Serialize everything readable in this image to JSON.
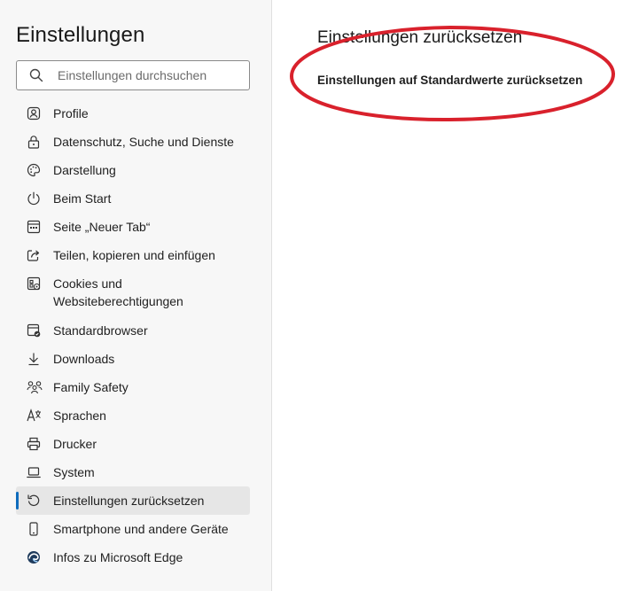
{
  "sidebar": {
    "title": "Einstellungen",
    "search": {
      "placeholder": "Einstellungen durchsuchen",
      "value": ""
    },
    "items": [
      {
        "label": "Profile",
        "icon": "profile-icon"
      },
      {
        "label": "Datenschutz, Suche und Dienste",
        "icon": "lock-icon"
      },
      {
        "label": "Darstellung",
        "icon": "palette-icon"
      },
      {
        "label": "Beim Start",
        "icon": "power-icon"
      },
      {
        "label": "Seite „Neuer Tab“",
        "icon": "new-tab-icon"
      },
      {
        "label": "Teilen, kopieren und einfügen",
        "icon": "share-icon"
      },
      {
        "label": "Cookies und Websiteberechtigungen",
        "icon": "cookies-icon"
      },
      {
        "label": "Standardbrowser",
        "icon": "default-browser-icon"
      },
      {
        "label": "Downloads",
        "icon": "download-icon"
      },
      {
        "label": "Family Safety",
        "icon": "family-icon"
      },
      {
        "label": "Sprachen",
        "icon": "languages-icon"
      },
      {
        "label": "Drucker",
        "icon": "printer-icon"
      },
      {
        "label": "System",
        "icon": "laptop-icon"
      },
      {
        "label": "Einstellungen zurücksetzen",
        "icon": "reset-icon",
        "active": true
      },
      {
        "label": "Smartphone und andere Geräte",
        "icon": "smartphone-icon"
      },
      {
        "label": "Infos zu Microsoft Edge",
        "icon": "edge-logo-icon"
      }
    ]
  },
  "main": {
    "title": "Einstellungen zurücksetzen",
    "reset_link": "Einstellungen auf Standardwerte zurücksetzen"
  },
  "colors": {
    "accent": "#0f6cbd",
    "annotation": "#d9212c",
    "sidebar_bg": "#f7f7f7",
    "active_bg": "#e6e6e6"
  }
}
